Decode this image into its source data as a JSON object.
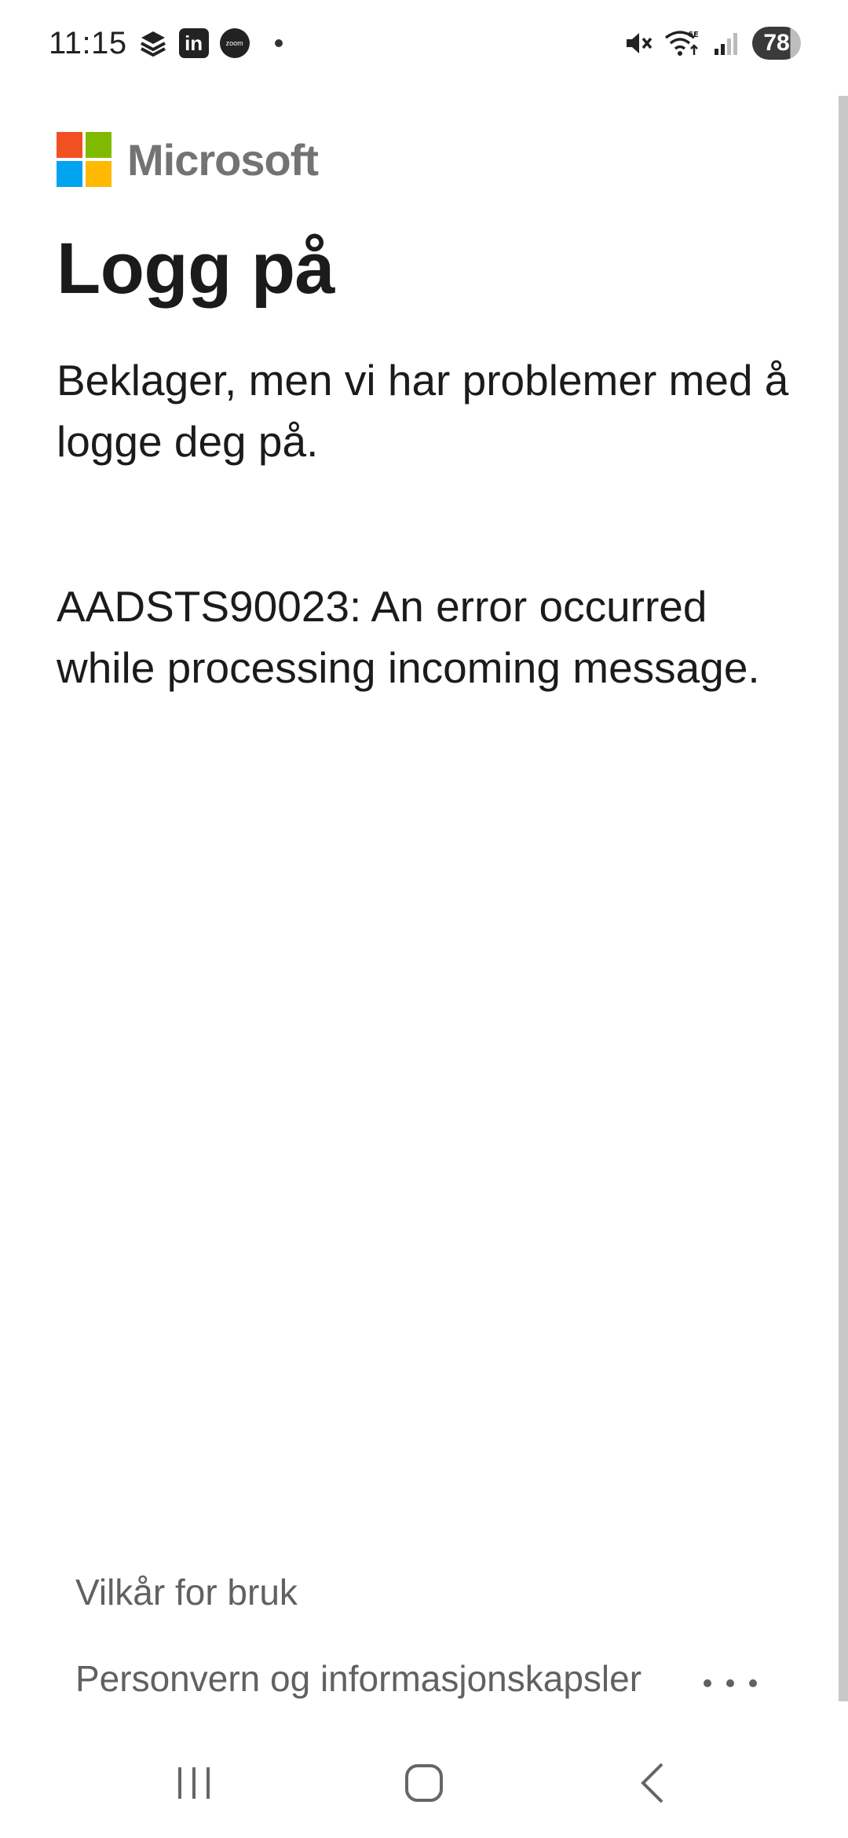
{
  "status_bar": {
    "time": "11:15",
    "notification_icons": [
      "stack-icon",
      "linkedin-icon",
      "zoom-icon",
      "more-notifications-dot"
    ],
    "linkedin_label": "in",
    "zoom_label": "zoom",
    "system_icons": [
      "mute-icon",
      "wifi-6e-icon",
      "signal-icon"
    ],
    "battery": "78"
  },
  "brand": {
    "name": "Microsoft"
  },
  "page": {
    "title": "Logg på",
    "message": "Beklager, men vi har problemer med å logge deg på.",
    "error": "AADSTS90023: An error occurred while processing incoming message."
  },
  "footer": {
    "terms_label": "Vilkår for bruk",
    "privacy_label": "Personvern og informasjonskapsler",
    "more_icon": "ellipsis-icon"
  },
  "nav_bar": {
    "buttons": [
      "recents-icon",
      "home-icon",
      "back-icon"
    ]
  },
  "colors": {
    "ms_red": "#f25022",
    "ms_green": "#7fba00",
    "ms_blue": "#00a4ef",
    "ms_yellow": "#ffb900",
    "text": "#1b1b1b",
    "footer_text": "#616161"
  }
}
